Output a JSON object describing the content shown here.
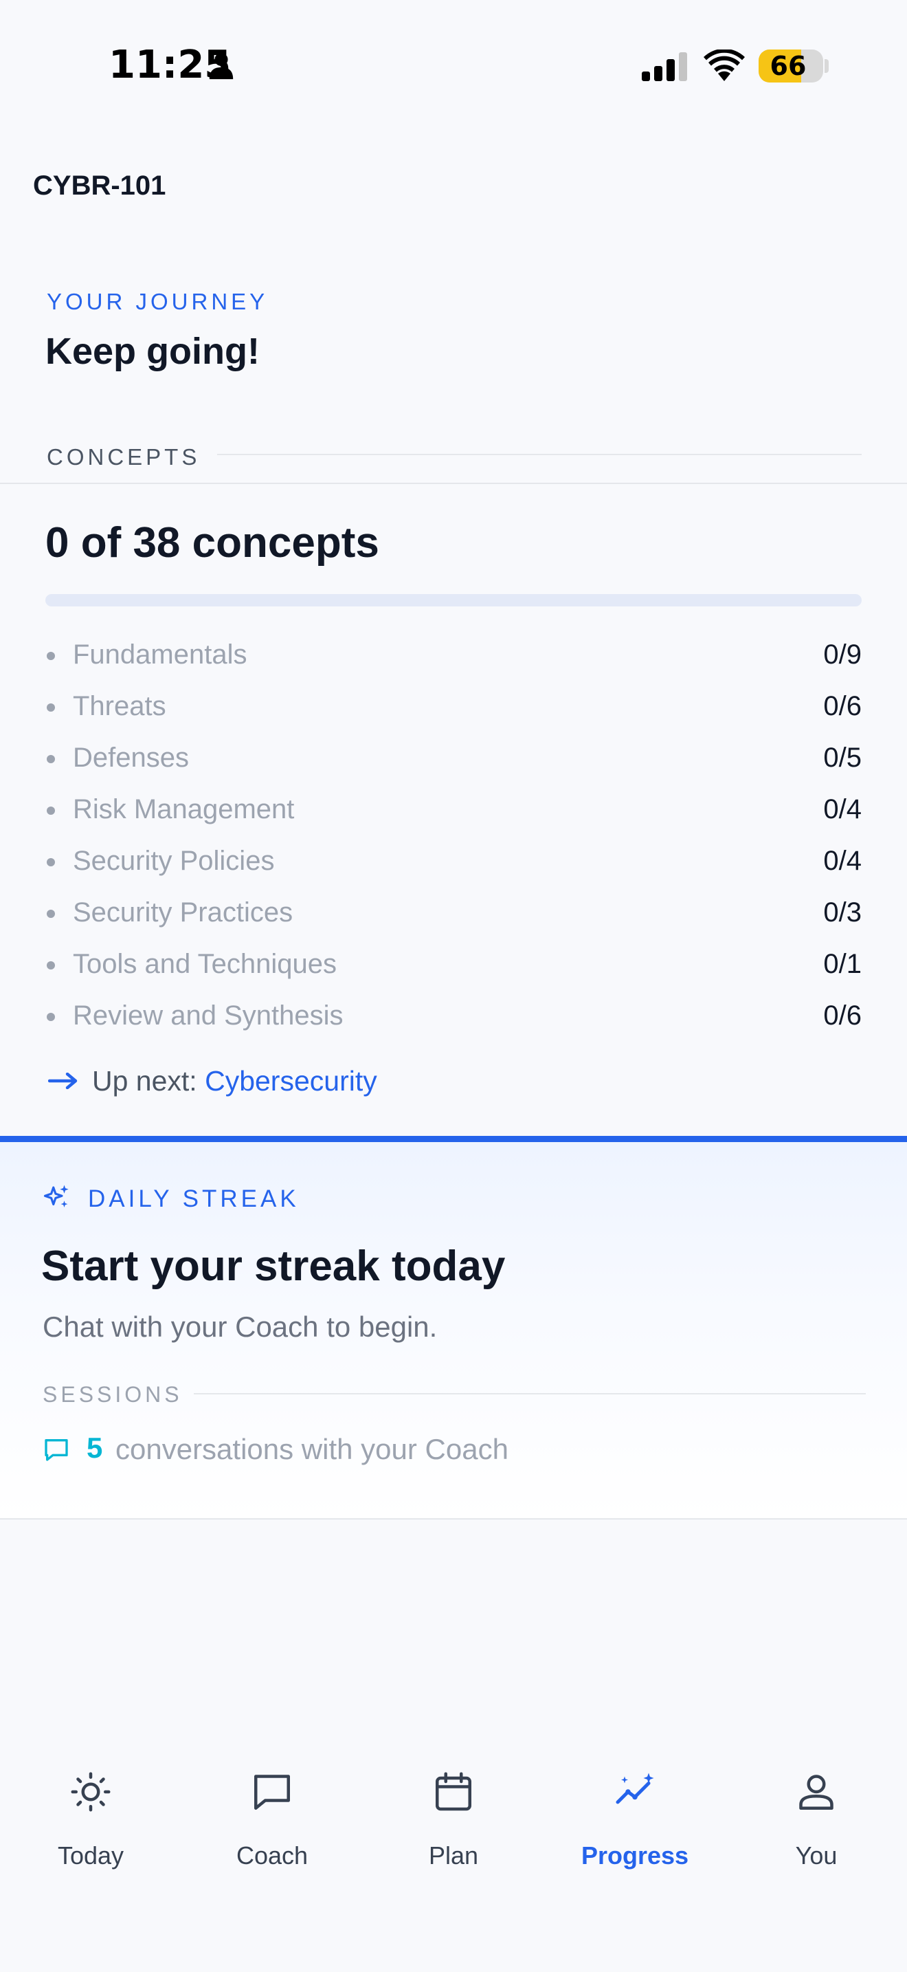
{
  "status_bar": {
    "time": "11:25",
    "battery_level": "66",
    "battery_fraction": 0.66,
    "icons": [
      "person-icon",
      "signal-icon",
      "wifi-icon",
      "battery-icon"
    ]
  },
  "header": {
    "course_code": "CYBR-101"
  },
  "journey": {
    "eyebrow": "YOUR JOURNEY",
    "heading": "Keep going!"
  },
  "concepts": {
    "section_label": "CONCEPTS",
    "total_text": "0 of 38 concepts",
    "completed": 0,
    "total": 38,
    "topics": [
      {
        "name": "Fundamentals",
        "count": "0/9"
      },
      {
        "name": "Threats",
        "count": "0/6"
      },
      {
        "name": "Defenses",
        "count": "0/5"
      },
      {
        "name": "Risk Management",
        "count": "0/4"
      },
      {
        "name": "Security Policies",
        "count": "0/4"
      },
      {
        "name": "Security Practices",
        "count": "0/3"
      },
      {
        "name": "Tools and Techniques",
        "count": "0/1"
      },
      {
        "name": "Review and Synthesis",
        "count": "0/6"
      }
    ],
    "up_next_prefix": "Up next: ",
    "up_next_link": "Cybersecurity",
    "up_next_icon": "arrow-right-icon"
  },
  "streak": {
    "eyebrow": "DAILY STREAK",
    "icon": "sparkles-icon",
    "heading": "Start your streak today",
    "subtitle": "Chat with your Coach to begin.",
    "sessions_label": "SESSIONS",
    "sessions_count": "5",
    "sessions_text": "conversations with your Coach",
    "sessions_icon": "chat-bubble-icon"
  },
  "tab_bar": {
    "active": "Progress",
    "tabs": [
      {
        "label": "Today",
        "icon": "sun-icon"
      },
      {
        "label": "Coach",
        "icon": "chat-bubble-icon"
      },
      {
        "label": "Plan",
        "icon": "calendar-icon"
      },
      {
        "label": "Progress",
        "icon": "trend-sparkle-icon"
      },
      {
        "label": "You",
        "icon": "user-icon"
      }
    ]
  },
  "colors": {
    "accent": "#2563eb",
    "teal": "#06b6d4",
    "muted_text": "#9ca3af",
    "background": "#f8f9fc",
    "battery": "#f6c415"
  }
}
